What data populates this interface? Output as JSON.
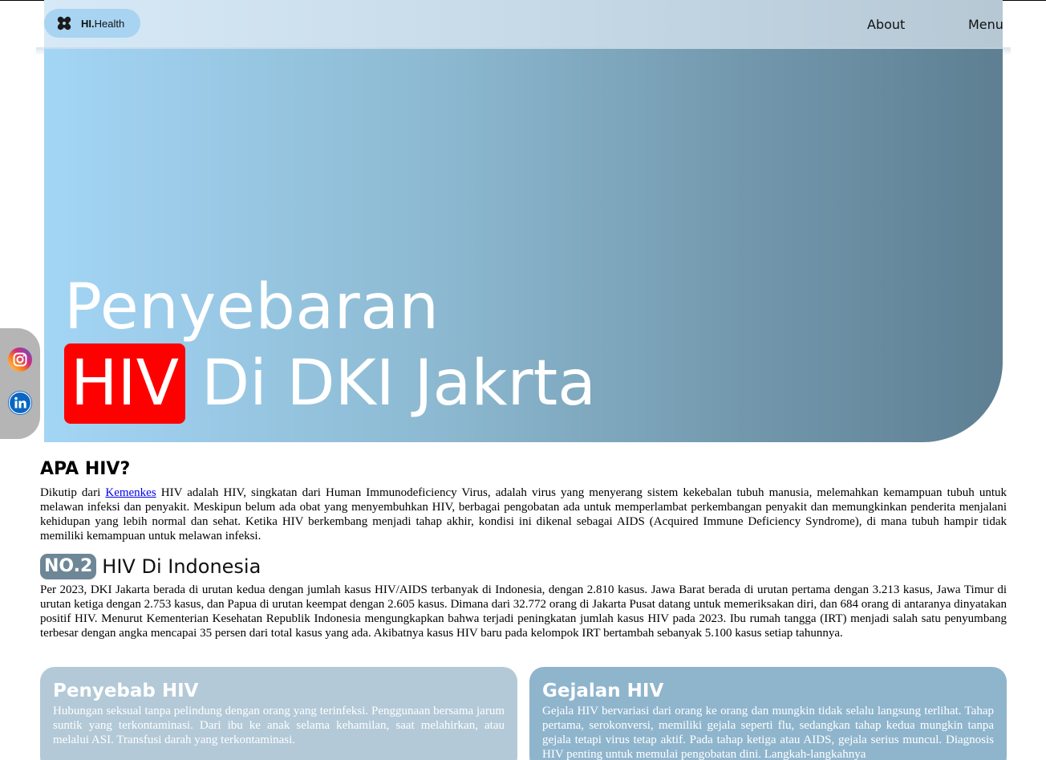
{
  "nav": {
    "logo_bold": "HI.",
    "logo_rest": "Health",
    "about": "About",
    "menu": "Menu"
  },
  "hero": {
    "line1": "Penyebaran",
    "highlight": "HIV",
    "line2_rest": "Di DKI Jakrta",
    "highlight_color": "#ff0000"
  },
  "social": {
    "icons": [
      "instagram-icon",
      "linkedin-icon"
    ]
  },
  "section1": {
    "title": "APA HIV?",
    "prefix": "Dikutip dari ",
    "link": "Kemenkes",
    "body": " HIV adalah HIV, singkatan dari Human Immunodeficiency Virus, adalah virus yang menyerang sistem kekebalan tubuh manusia, melemahkan kemampuan tubuh untuk melawan infeksi dan penyakit. Meskipun belum ada obat yang menyembuhkan HIV, berbagai pengobatan ada untuk memperlambat perkembangan penyakit dan memungkinkan penderita menjalani kehidupan yang lebih normal dan sehat. Ketika HIV berkembang menjadi tahap akhir, kondisi ini dikenal sebagai AIDS (Acquired Immune Deficiency Syndrome), di mana tubuh hampir tidak memiliki kemampuan untuk melawan infeksi."
  },
  "section2": {
    "badge": "NO.2",
    "title": "HIV Di Indonesia",
    "body": "Per 2023, DKI Jakarta berada di urutan kedua dengan jumlah kasus HIV/AIDS terbanyak di Indonesia, dengan 2.810 kasus. Jawa Barat berada di urutan pertama dengan 3.213 kasus, Jawa Timur di urutan ketiga dengan 2.753 kasus, dan Papua di urutan keempat dengan 2.605 kasus. Dimana dari 32.772 orang di Jakarta Pusat datang untuk memeriksakan diri, dan 684 orang di antaranya dinyatakan positif HIV. Menurut Kementerian Kesehatan Republik Indonesia mengungkapkan bahwa terjadi peningkatan jumlah kasus HIV pada 2023. Ibu rumah tangga (IRT) menjadi salah satu penyumbang terbesar dengan angka mencapai 35 persen dari total kasus yang ada. Akibatnya kasus HIV baru pada kelompok IRT bertambah sebanyak 5.100 kasus setiap tahunnya."
  },
  "cards": {
    "left": {
      "title": "Penyebab HIV",
      "body": "Hubungan seksual tanpa pelindung dengan orang yang terinfeksi. Penggunaan bersama jarum suntik yang terkontaminasi. Dari ibu ke anak selama kehamilan, saat melahirkan, atau melalui ASI. Transfusi darah yang terkontaminasi."
    },
    "right": {
      "title": "Gejalan HIV",
      "body": "Gejala HIV bervariasi dari orang ke orang dan mungkin tidak selalu langsung terlihat. Tahap pertama, serokonversi, memiliki gejala seperti flu, sedangkan tahap kedua mungkin tanpa gejala tetapi virus tetap aktif. Pada tahap ketiga atau AIDS, gejala serius muncul. Diagnosis HIV penting untuk memulai pengobatan dini. Langkah-langkahnya"
    }
  }
}
